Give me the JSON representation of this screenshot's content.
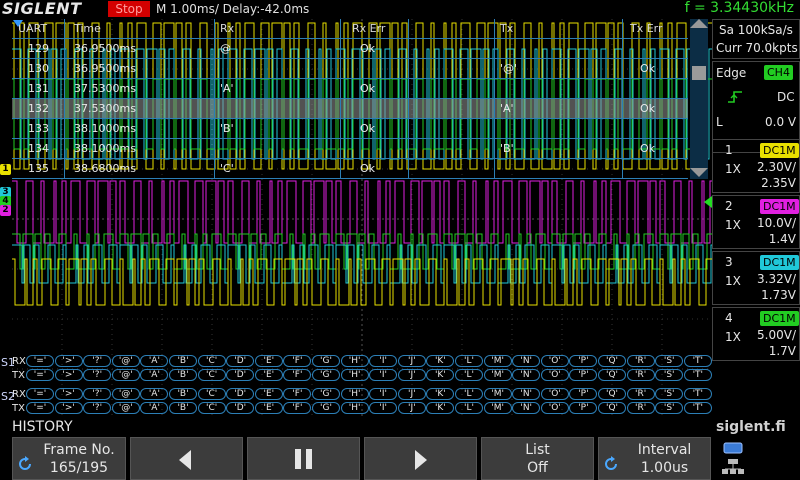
{
  "header": {
    "logo": "SIGLENT",
    "run_state": "Stop",
    "timebase": "M 1.00ms/ Delay:-42.0ms",
    "frequency": "f = 3.34430kHz"
  },
  "decode_table": {
    "columns": [
      "UART",
      "Time",
      "Rx",
      "Rx Err",
      "Tx",
      "Tx Err"
    ],
    "rows": [
      {
        "idx": "129",
        "time": "36.9500ms",
        "rx": "@",
        "rx_err": "Ok",
        "tx": "",
        "tx_err": ""
      },
      {
        "idx": "130",
        "time": "36.9500ms",
        "rx": "",
        "rx_err": "",
        "tx": "'@'",
        "tx_err": "Ok"
      },
      {
        "idx": "131",
        "time": "37.5300ms",
        "rx": "'A'",
        "rx_err": "Ok",
        "tx": "",
        "tx_err": ""
      },
      {
        "idx": "132",
        "time": "37.5300ms",
        "rx": "",
        "rx_err": "",
        "tx": "'A'",
        "tx_err": "Ok"
      },
      {
        "idx": "133",
        "time": "38.1000ms",
        "rx": "'B'",
        "rx_err": "Ok",
        "tx": "",
        "tx_err": ""
      },
      {
        "idx": "134",
        "time": "38.1000ms",
        "rx": "",
        "rx_err": "",
        "tx": "'B'",
        "tx_err": "Ok"
      },
      {
        "idx": "135",
        "time": "38.6800ms",
        "rx": "'C'",
        "rx_err": "Ok",
        "tx": "",
        "tx_err": ""
      }
    ],
    "selected_row": 3
  },
  "channel_markers": [
    "1",
    "3",
    "4",
    "2"
  ],
  "bus": {
    "s1": "S1",
    "s2": "S2",
    "rx_label": "RX",
    "tx_label": "TX",
    "s1_rx_symbols": [
      "'='",
      "'>'",
      "'?'",
      "'@'",
      "'A'",
      "'B'",
      "'C'",
      "'D'",
      "'E'",
      "'F'",
      "'G'",
      "'H'",
      "'I'",
      "'J'",
      "'K'",
      "'L'",
      "'M'",
      "'N'",
      "'O'",
      "'P'",
      "'Q'",
      "'R'",
      "'S'",
      "'T'"
    ],
    "s1_tx_symbols": [
      "'='",
      "'>'",
      "'?'",
      "'@'",
      "'A'",
      "'B'",
      "'C'",
      "'D'",
      "'E'",
      "'F'",
      "'G'",
      "'H'",
      "'I'",
      "'J'",
      "'K'",
      "'L'",
      "'M'",
      "'N'",
      "'O'",
      "'P'",
      "'Q'",
      "'R'",
      "'S'",
      "'T'"
    ],
    "s2_rx_symbols": [
      "'='",
      "'>'",
      "'?'",
      "'@'",
      "'A'",
      "'B'",
      "'C'",
      "'D'",
      "'E'",
      "'F'",
      "'G'",
      "'H'",
      "'I'",
      "'J'",
      "'K'",
      "'L'",
      "'M'",
      "'N'",
      "'O'",
      "'P'",
      "'Q'",
      "'R'",
      "'S'",
      "'T'"
    ],
    "s2_tx_symbols": [
      "'='",
      "'>'",
      "'?'",
      "'@'",
      "'A'",
      "'B'",
      "'C'",
      "'D'",
      "'E'",
      "'F'",
      "'G'",
      "'H'",
      "'I'",
      "'J'",
      "'K'",
      "'L'",
      "'M'",
      "'N'",
      "'O'",
      "'P'",
      "'Q'",
      "'R'",
      "'S'",
      "'T'"
    ]
  },
  "acquisition": {
    "sample_rate": "Sa 100kSa/s",
    "memory": "Curr 70.0kpts"
  },
  "trigger": {
    "type": "Edge",
    "source": "CH4",
    "coupling": "DC",
    "level_label": "L",
    "level": "0.0 V"
  },
  "channels": [
    {
      "num": "1",
      "coupling": "DC1M",
      "probe": "1X",
      "scale": "2.30V/",
      "offset": "2.35V",
      "color": "#e8e000"
    },
    {
      "num": "2",
      "coupling": "DC1M",
      "probe": "1X",
      "scale": "10.0V/",
      "offset": "1.4V",
      "color": "#e020e0"
    },
    {
      "num": "3",
      "coupling": "DC1M",
      "probe": "1X",
      "scale": "3.32V/",
      "offset": "1.73V",
      "color": "#20c8d8"
    },
    {
      "num": "4",
      "coupling": "DC1M",
      "probe": "1X",
      "scale": "5.00V/",
      "offset": "1.7V",
      "color": "#22cc22"
    }
  ],
  "footer": {
    "mode": "HISTORY",
    "brand": "siglent.fi"
  },
  "menu": {
    "frame_label": "Frame No.",
    "frame_value": "165/195",
    "prev_icon": "triangle-left-icon",
    "pause_icon": "pause-icon",
    "next_icon": "triangle-right-icon",
    "list_label": "List",
    "list_value": "Off",
    "interval_label": "Interval",
    "interval_value": "1.00us"
  },
  "colors": {
    "ch1": "#e8e000",
    "ch2": "#e020e0",
    "ch3": "#20c8d8",
    "ch4": "#22cc22",
    "grid": "#2c7fb6",
    "stop": "#d40000",
    "frequency": "#33dd33"
  }
}
